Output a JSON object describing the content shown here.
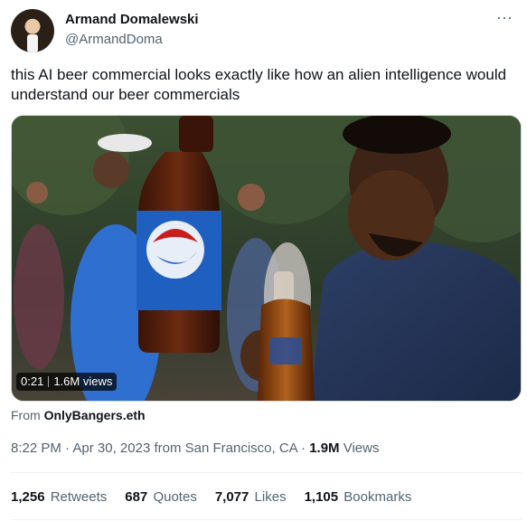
{
  "author": {
    "display_name": "Armand Domalewski",
    "handle": "@ArmandDoma"
  },
  "tweet": {
    "text": "this AI beer commercial looks exactly like how an alien intelligence would  understand our beer commercials"
  },
  "media": {
    "duration": "0:21",
    "views": "1.6M views",
    "attribution_prefix": "From",
    "attribution_source": "OnlyBangers.eth"
  },
  "meta": {
    "time": "8:22 PM",
    "date": "Apr 30, 2023",
    "location": "from San Francisco, CA",
    "views_count": "1.9M",
    "views_label": "Views"
  },
  "stats": {
    "retweets_count": "1,256",
    "retweets_label": "Retweets",
    "quotes_count": "687",
    "quotes_label": "Quotes",
    "likes_count": "7,077",
    "likes_label": "Likes",
    "bookmarks_count": "1,105",
    "bookmarks_label": "Bookmarks"
  },
  "icons": {
    "more": "more-horizontal-icon"
  },
  "colors": {
    "secondary_text": "#536471",
    "primary_text": "#0f1419",
    "divider": "#eff3f4",
    "bottle_label": "#1f5fbf"
  }
}
